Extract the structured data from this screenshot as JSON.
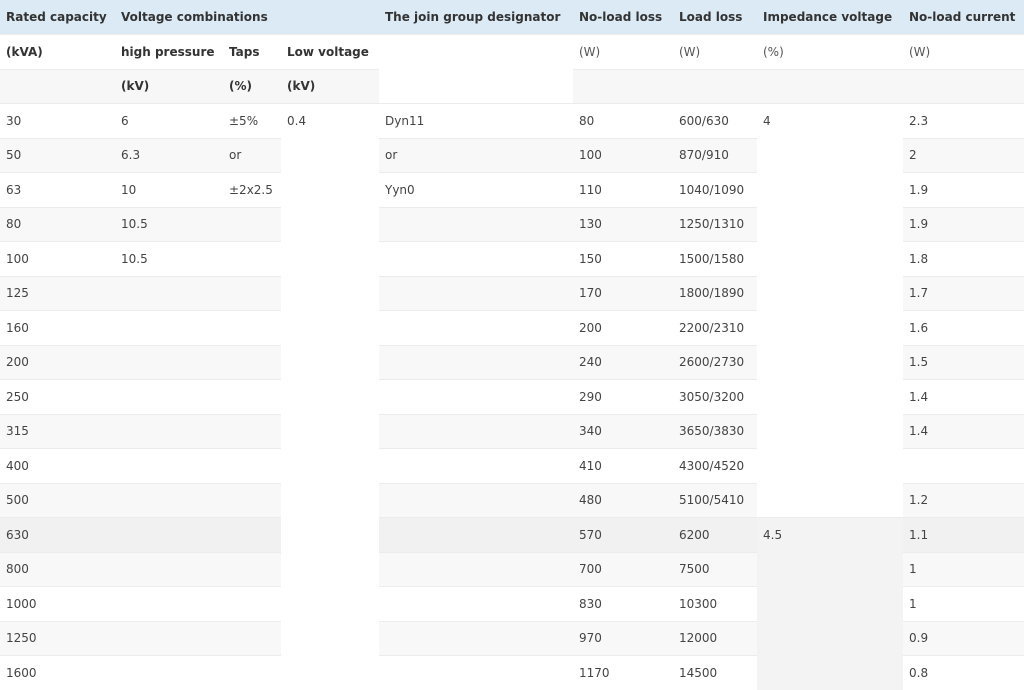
{
  "header": {
    "row1": [
      "Rated capacity",
      "Voltage combinations",
      "",
      "",
      "The join group designator",
      "No-load loss",
      "Load loss",
      "Impedance voltage",
      "No-load current"
    ],
    "row2": [
      "(kVA)",
      "high pressure",
      "Taps",
      "Low voltage",
      "",
      "(W)",
      "(W)",
      "(%)",
      "(W)"
    ],
    "row3": [
      "",
      "(kV)",
      "(%)",
      "(kV)",
      "",
      "",
      "",
      "",
      ""
    ]
  },
  "low_voltage": "0.4",
  "impedance": [
    {
      "value": "4",
      "rows": 12
    },
    {
      "value": "4.5",
      "rows": 5
    }
  ],
  "rows": [
    {
      "capacity": "30",
      "hv": "6",
      "taps": "±5%",
      "group": "Dyn11",
      "noload": "80",
      "load": "600/630",
      "current": "2.3"
    },
    {
      "capacity": "50",
      "hv": "6.3",
      "taps": "or",
      "group": "or",
      "noload": "100",
      "load": "870/910",
      "current": "2"
    },
    {
      "capacity": "63",
      "hv": "10",
      "taps": "±2x2.5",
      "group": "Yyn0",
      "noload": "110",
      "load": "1040/1090",
      "current": "1.9"
    },
    {
      "capacity": "80",
      "hv": "10.5",
      "taps": "",
      "group": "",
      "noload": "130",
      "load": "1250/1310",
      "current": "1.9"
    },
    {
      "capacity": "100",
      "hv": "10.5",
      "taps": "",
      "group": "",
      "noload": "150",
      "load": "1500/1580",
      "current": "1.8"
    },
    {
      "capacity": "125",
      "hv": "",
      "taps": "",
      "group": "",
      "noload": "170",
      "load": "1800/1890",
      "current": "1.7"
    },
    {
      "capacity": "160",
      "hv": "",
      "taps": "",
      "group": "",
      "noload": "200",
      "load": "2200/2310",
      "current": "1.6"
    },
    {
      "capacity": "200",
      "hv": "",
      "taps": "",
      "group": "",
      "noload": "240",
      "load": "2600/2730",
      "current": "1.5"
    },
    {
      "capacity": "250",
      "hv": "",
      "taps": "",
      "group": "",
      "noload": "290",
      "load": "3050/3200",
      "current": "1.4"
    },
    {
      "capacity": "315",
      "hv": "",
      "taps": "",
      "group": "",
      "noload": "340",
      "load": "3650/3830",
      "current": "1.4"
    },
    {
      "capacity": "400",
      "hv": "",
      "taps": "",
      "group": "",
      "noload": "410",
      "load": "4300/4520",
      "current": ""
    },
    {
      "capacity": "500",
      "hv": "",
      "taps": "",
      "group": "",
      "noload": "480",
      "load": "5100/5410",
      "current": "1.2"
    },
    {
      "capacity": "630",
      "hv": "",
      "taps": "",
      "group": "",
      "noload": "570",
      "load": "6200",
      "current": "1.1"
    },
    {
      "capacity": "800",
      "hv": "",
      "taps": "",
      "group": "",
      "noload": "700",
      "load": "7500",
      "current": "1"
    },
    {
      "capacity": "1000",
      "hv": "",
      "taps": "",
      "group": "",
      "noload": "830",
      "load": "10300",
      "current": "1"
    },
    {
      "capacity": "1250",
      "hv": "",
      "taps": "",
      "group": "",
      "noload": "970",
      "load": "12000",
      "current": "0.9"
    },
    {
      "capacity": "1600",
      "hv": "",
      "taps": "",
      "group": "",
      "noload": "1170",
      "load": "14500",
      "current": "0.8"
    }
  ],
  "colors": {
    "header_bg": "#dbeaf5",
    "stripe": "#f8f8f8",
    "highlight_row": "#f1f1f1"
  }
}
